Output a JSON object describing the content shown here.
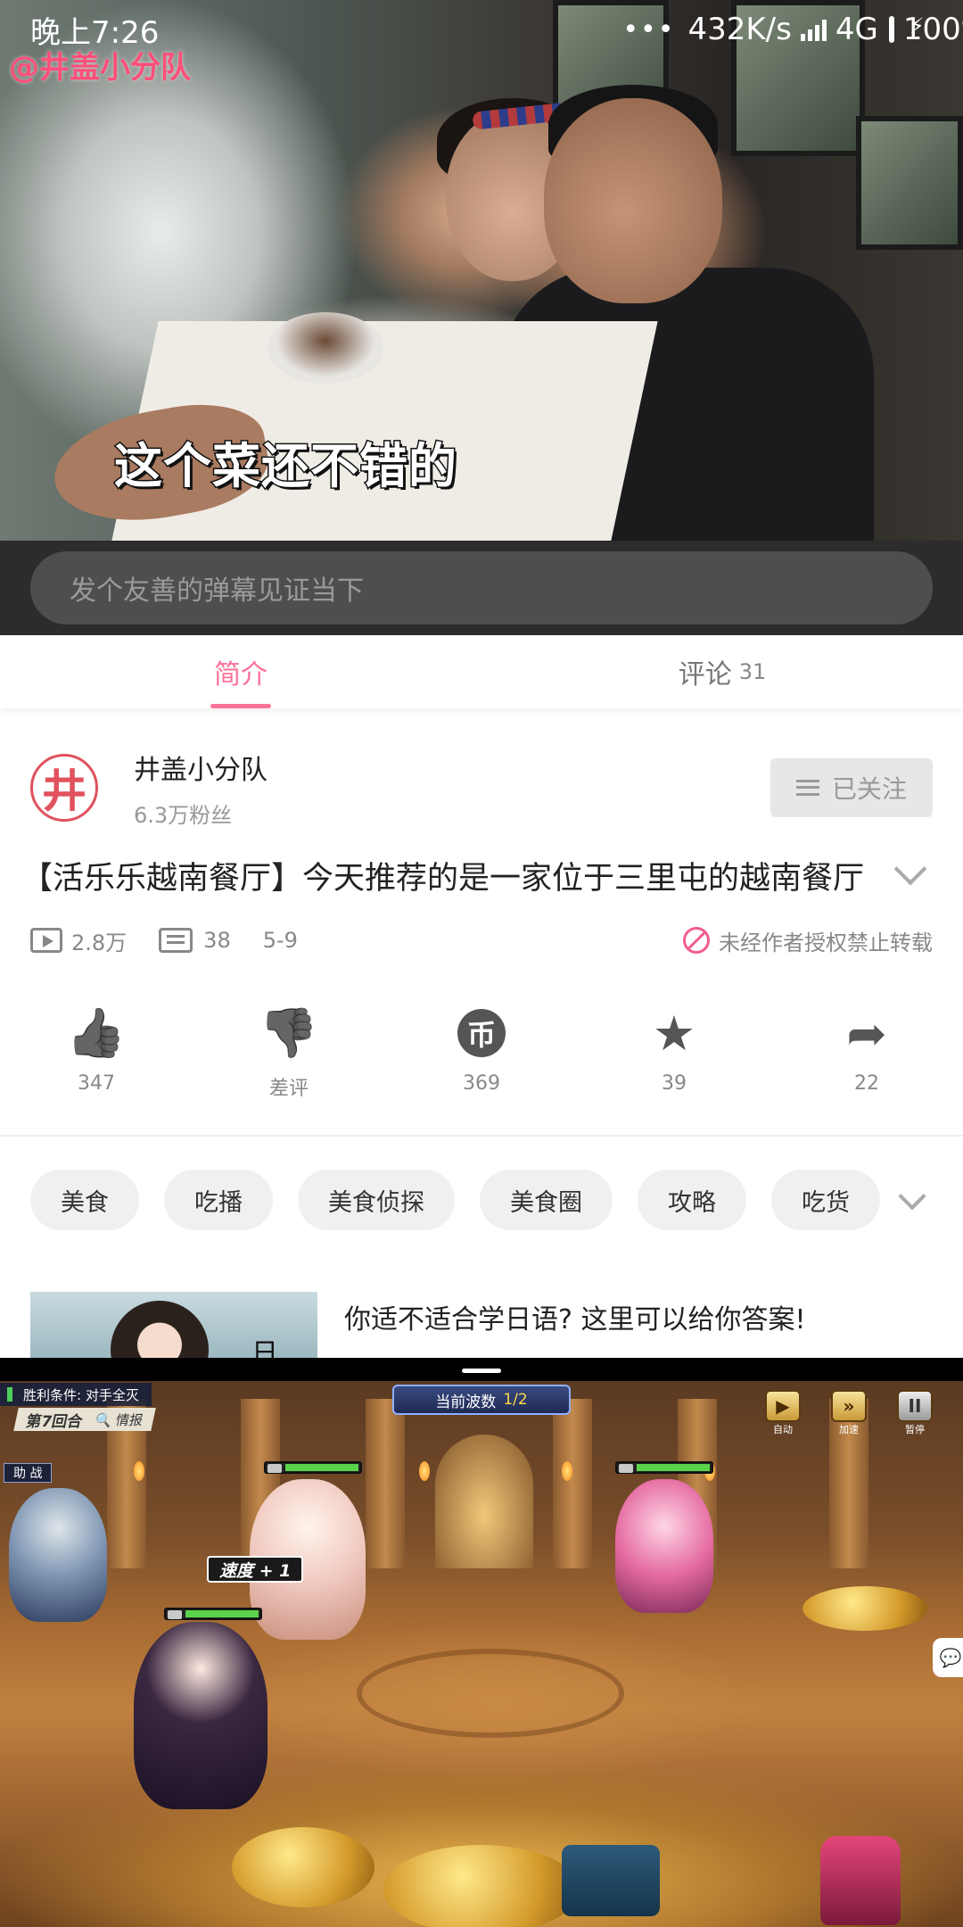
{
  "status_bar": {
    "time": "晚上7:26",
    "dots": "•••",
    "speed": "432K/s",
    "network": "4G",
    "battery": "100%"
  },
  "video": {
    "watermark": "@井盖小分队",
    "subtitle": "这个菜还不错的"
  },
  "danmaku": {
    "placeholder": "发个友善的弹幕见证当下"
  },
  "tabs": [
    {
      "label": "简介",
      "count": ""
    },
    {
      "label": "评论",
      "count": "31"
    }
  ],
  "uploader": {
    "avatar_char": "井",
    "name": "井盖小分队",
    "fans": "6.3万粉丝",
    "follow_label": "已关注"
  },
  "video_info": {
    "title": "【活乐乐越南餐厅】今天推荐的是一家位于三里屯的越南餐厅",
    "plays": "2.8万",
    "danmaku_count": "38",
    "date": "5-9",
    "copyright_notice": "未经作者授权禁止转载"
  },
  "actions": [
    {
      "icon": "thumbs-up-icon",
      "glyph": "👍",
      "label": "347"
    },
    {
      "icon": "thumbs-down-icon",
      "glyph": "👎",
      "label": "差评"
    },
    {
      "icon": "coin-icon",
      "glyph": "币",
      "label": "369"
    },
    {
      "icon": "star-icon",
      "glyph": "★",
      "label": "39"
    },
    {
      "icon": "share-icon",
      "glyph": "➦",
      "label": "22"
    }
  ],
  "tags": [
    "美食",
    "吃播",
    "美食侦探",
    "美食圈",
    "攻略",
    "吃货"
  ],
  "recommend": {
    "title": "你适不适合学日语? 这里可以给你答案!",
    "thumb_char": "日"
  },
  "game": {
    "win_condition": "胜利条件: 对手全灭",
    "round": "第7回合",
    "intel": "情报",
    "wave_label": "当前波数",
    "wave_value": "1/2",
    "auto_label": "自动",
    "speed_label": "加速",
    "pause_label": "暂停",
    "assist_label": "助 战",
    "buff_label": "速度 + 1",
    "chat_glyph": "💬"
  },
  "colors": {
    "accent": "#fb7299",
    "avatar": "#e0525d",
    "danmaku_bg": "#2c2c2c"
  }
}
